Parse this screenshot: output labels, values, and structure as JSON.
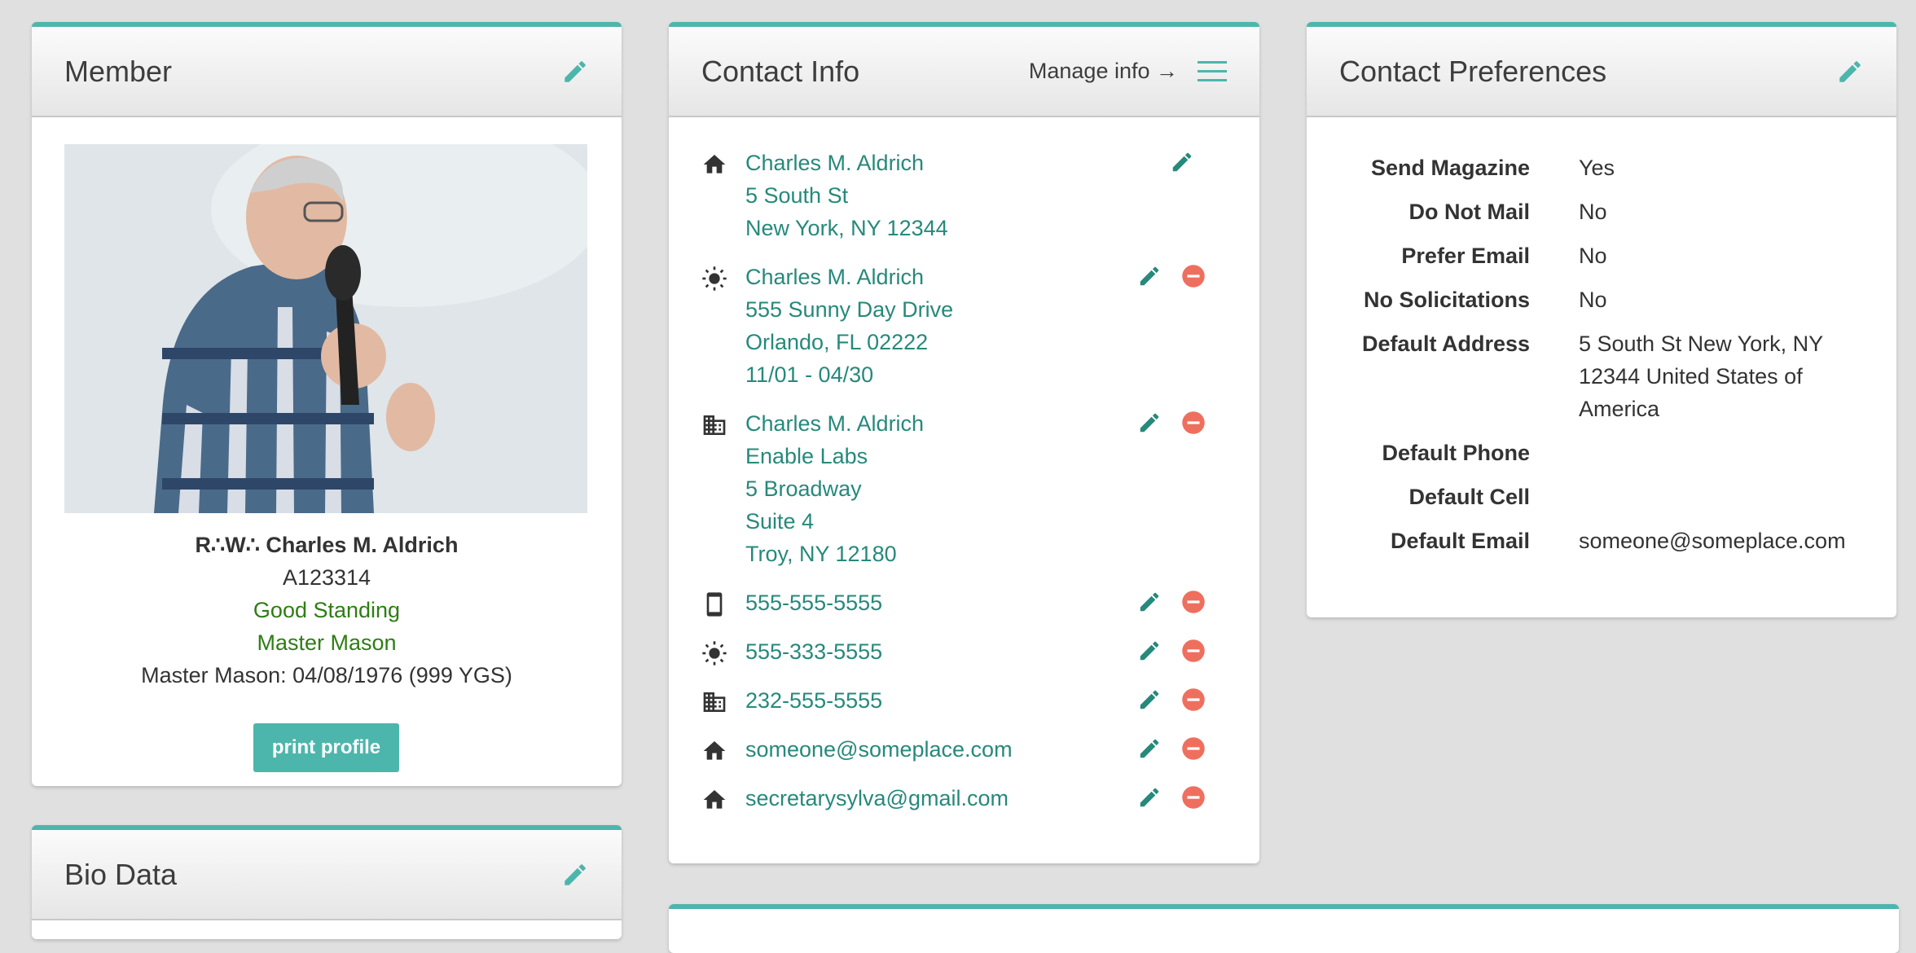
{
  "member_card": {
    "title": "Member",
    "name_prefix": "R∴W∴",
    "name": "Charles M. Aldrich",
    "member_id": "A123314",
    "standing": "Good Standing",
    "degree": "Master Mason",
    "degree_detail": "Master Mason: 04/08/1976 (999 YGS)",
    "print_label": "print profile"
  },
  "bio_card": {
    "title": "Bio Data"
  },
  "contact_card": {
    "title": "Contact Info",
    "manage_label": "Manage info →",
    "entries": [
      {
        "icon": "home-icon",
        "lines": [
          "Charles M. Aldrich",
          "5 South St",
          "New York, NY 12344"
        ]
      },
      {
        "icon": "sun-icon",
        "lines": [
          "Charles M. Aldrich",
          "555 Sunny Day Drive",
          "Orlando, FL 02222",
          "11/01 - 04/30"
        ]
      },
      {
        "icon": "business-icon",
        "lines": [
          "Charles M. Aldrich",
          "Enable Labs",
          "5 Broadway",
          "Suite 4",
          "Troy, NY 12180"
        ]
      },
      {
        "icon": "mobile-icon",
        "lines": [
          "555-555-5555"
        ]
      },
      {
        "icon": "sun-icon",
        "lines": [
          "555-333-5555"
        ]
      },
      {
        "icon": "business-icon",
        "lines": [
          "232-555-5555"
        ]
      },
      {
        "icon": "home-icon",
        "lines": [
          "someone@someplace.com"
        ]
      },
      {
        "icon": "home-icon",
        "lines": [
          "secretarysylva@gmail.com"
        ]
      }
    ]
  },
  "prefs_card": {
    "title": "Contact Preferences",
    "rows": [
      {
        "label": "Send Magazine",
        "value": "Yes"
      },
      {
        "label": "Do Not Mail",
        "value": "No"
      },
      {
        "label": "Prefer Email",
        "value": "No"
      },
      {
        "label": "No Solicitations",
        "value": "No"
      },
      {
        "label": "Default Address",
        "value": "5 South St New York, NY 12344 United States of America"
      },
      {
        "label": "Default Phone",
        "value": ""
      },
      {
        "label": "Default Cell",
        "value": ""
      },
      {
        "label": "Default Email",
        "value": "someone@someplace.com"
      }
    ]
  },
  "colors": {
    "accent": "#4db6ac",
    "link": "#26897b",
    "status": "#2e7d15",
    "remove": "#ef6f5e"
  }
}
